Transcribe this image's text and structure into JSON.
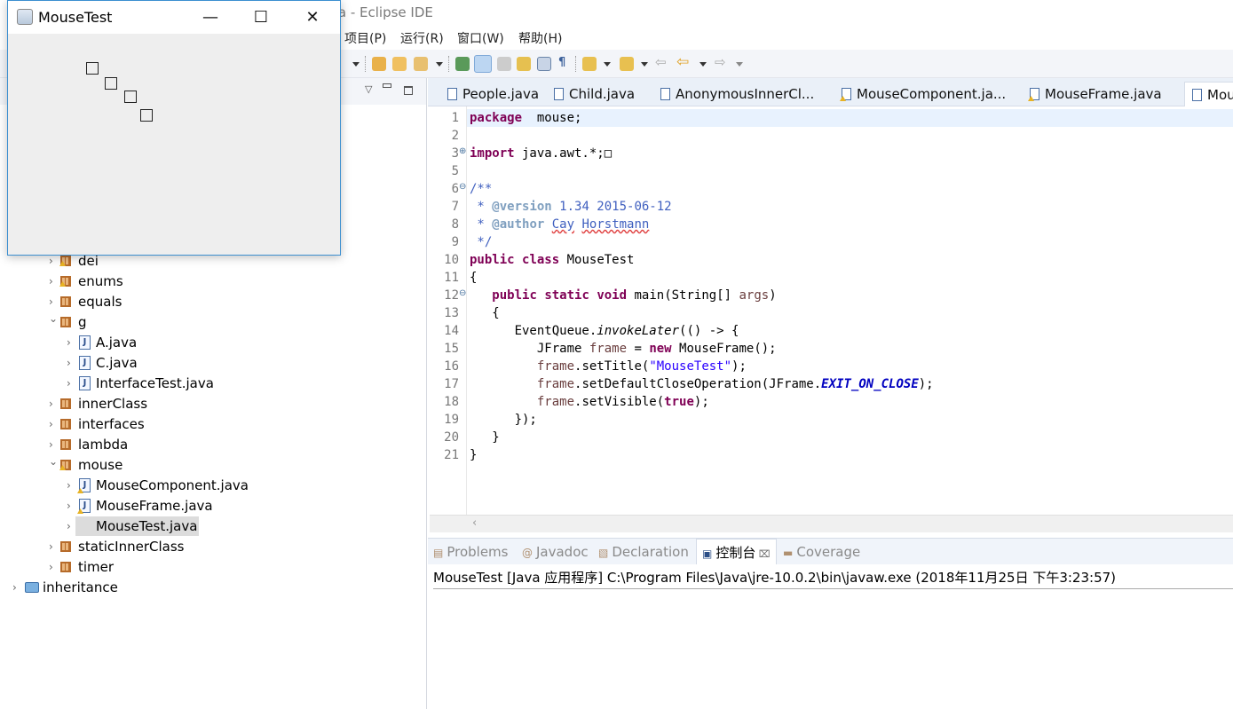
{
  "eclipse": {
    "title": "va - Eclipse IDE",
    "menu": [
      "项目(P)",
      "运行(R)",
      "窗口(W)",
      "帮助(H)"
    ]
  },
  "explorer": {
    "items": [
      {
        "label": "dei",
        "level": 1,
        "type": "package",
        "expanded": false,
        "warning": true
      },
      {
        "label": "enums",
        "level": 1,
        "type": "package",
        "expanded": false,
        "warning": true
      },
      {
        "label": "equals",
        "level": 1,
        "type": "package",
        "expanded": false
      },
      {
        "label": "g",
        "level": 1,
        "type": "package",
        "expanded": true
      },
      {
        "label": "A.java",
        "level": 2,
        "type": "file"
      },
      {
        "label": "C.java",
        "level": 2,
        "type": "file"
      },
      {
        "label": "InterfaceTest.java",
        "level": 2,
        "type": "file"
      },
      {
        "label": "innerClass",
        "level": 1,
        "type": "package",
        "expanded": false
      },
      {
        "label": "interfaces",
        "level": 1,
        "type": "package",
        "expanded": false
      },
      {
        "label": "lambda",
        "level": 1,
        "type": "package",
        "expanded": false
      },
      {
        "label": "mouse",
        "level": 1,
        "type": "package",
        "expanded": true,
        "warning": true
      },
      {
        "label": "MouseComponent.java",
        "level": 2,
        "type": "file",
        "warning": true
      },
      {
        "label": "MouseFrame.java",
        "level": 2,
        "type": "file",
        "warning": true
      },
      {
        "label": "MouseTest.java",
        "level": 2,
        "type": "file",
        "selected": true
      },
      {
        "label": "staticInnerClass",
        "level": 1,
        "type": "package",
        "expanded": false
      },
      {
        "label": "timer",
        "level": 1,
        "type": "package",
        "expanded": false
      },
      {
        "label": "inheritance",
        "level": 0,
        "type": "project",
        "expanded": false
      }
    ]
  },
  "editor": {
    "tabs": [
      {
        "label": "People.java"
      },
      {
        "label": "Child.java"
      },
      {
        "label": "AnonymousInnerCl..."
      },
      {
        "label": "MouseComponent.ja...",
        "warning": true
      },
      {
        "label": "MouseFrame.java",
        "warning": true
      },
      {
        "label": "Mou",
        "active": true
      }
    ],
    "lines": [
      {
        "n": "1",
        "t": [
          [
            "kw",
            "package"
          ],
          [
            "",
            "  mouse;"
          ]
        ]
      },
      {
        "n": "2",
        "t": []
      },
      {
        "n": "3",
        "fold": "⊕",
        "t": [
          [
            "kw",
            "import"
          ],
          [
            "",
            " java.awt.*;"
          ],
          [
            "",
            "□"
          ]
        ]
      },
      {
        "n": "5",
        "t": []
      },
      {
        "n": "6",
        "fold": "⊖",
        "t": [
          [
            "cm",
            "/**"
          ]
        ]
      },
      {
        "n": "7",
        "t": [
          [
            "cm",
            " * "
          ],
          [
            "tag",
            "@version"
          ],
          [
            "cm",
            " 1.34 2015-06-12"
          ]
        ]
      },
      {
        "n": "8",
        "t": [
          [
            "cm",
            " * "
          ],
          [
            "tag",
            "@author"
          ],
          [
            "cm",
            " "
          ],
          [
            "cm squig",
            "Cay"
          ],
          [
            "cm",
            " "
          ],
          [
            "cm squig",
            "Horstmann"
          ]
        ]
      },
      {
        "n": "9",
        "t": [
          [
            "cm",
            " */"
          ]
        ]
      },
      {
        "n": "10",
        "t": [
          [
            "kw",
            "public"
          ],
          [
            "",
            " "
          ],
          [
            "kw",
            "class"
          ],
          [
            "",
            " MouseTest"
          ]
        ]
      },
      {
        "n": "11",
        "t": [
          [
            "",
            "{"
          ]
        ]
      },
      {
        "n": "12",
        "fold": "⊖",
        "t": [
          [
            "",
            "   "
          ],
          [
            "kw",
            "public"
          ],
          [
            "",
            " "
          ],
          [
            "kw",
            "static"
          ],
          [
            "",
            " "
          ],
          [
            "kw",
            "void"
          ],
          [
            "",
            " main(String[] "
          ],
          [
            "par",
            "args"
          ],
          [
            "",
            ")"
          ]
        ]
      },
      {
        "n": "13",
        "t": [
          [
            "",
            "   {"
          ]
        ]
      },
      {
        "n": "14",
        "t": [
          [
            "",
            "      EventQueue."
          ],
          [
            "it",
            "invokeLater"
          ],
          [
            "",
            "(() -> {"
          ]
        ]
      },
      {
        "n": "15",
        "t": [
          [
            "",
            "         JFrame "
          ],
          [
            "par",
            "frame"
          ],
          [
            "",
            " = "
          ],
          [
            "kw",
            "new"
          ],
          [
            "",
            " MouseFrame();"
          ]
        ]
      },
      {
        "n": "16",
        "t": [
          [
            "",
            "         "
          ],
          [
            "par",
            "frame"
          ],
          [
            "",
            ".setTitle("
          ],
          [
            "str",
            "\"MouseTest\""
          ],
          [
            "",
            ");"
          ]
        ]
      },
      {
        "n": "17",
        "t": [
          [
            "",
            "         "
          ],
          [
            "par",
            "frame"
          ],
          [
            "",
            ".setDefaultCloseOperation(JFrame."
          ],
          [
            "sfld",
            "EXIT_ON_CLOSE"
          ],
          [
            "",
            ");"
          ]
        ]
      },
      {
        "n": "18",
        "t": [
          [
            "",
            "         "
          ],
          [
            "par",
            "frame"
          ],
          [
            "",
            ".setVisible("
          ],
          [
            "kw",
            "true"
          ],
          [
            "",
            ");"
          ]
        ]
      },
      {
        "n": "19",
        "t": [
          [
            "",
            "      });"
          ]
        ]
      },
      {
        "n": "20",
        "t": [
          [
            "",
            "   }"
          ]
        ]
      },
      {
        "n": "21",
        "t": [
          [
            "",
            "}"
          ]
        ]
      }
    ]
  },
  "bottom": {
    "tabs": [
      {
        "label": "Problems"
      },
      {
        "label": "Javadoc"
      },
      {
        "label": "Declaration"
      },
      {
        "label": "控制台",
        "active": true
      },
      {
        "label": "Coverage"
      }
    ],
    "console_line": "MouseTest [Java 应用程序] C:\\Program Files\\Java\\jre-10.0.2\\bin\\javaw.exe  (2018年11月25日 下午3:23:57)"
  },
  "swing_window": {
    "title": "MouseTest",
    "minimize": "—",
    "maximize": "☐",
    "close": "✕",
    "squares": [
      [
        96,
        69
      ],
      [
        117,
        86
      ],
      [
        139,
        101
      ],
      [
        157,
        122
      ]
    ]
  }
}
